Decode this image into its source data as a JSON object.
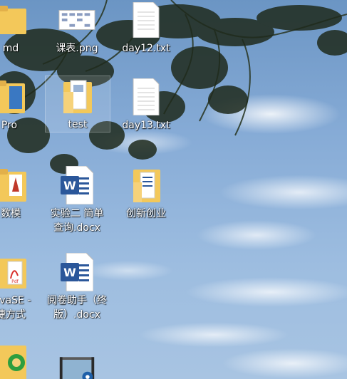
{
  "desktop": {
    "icons": [
      {
        "label": "md",
        "type": "folder"
      },
      {
        "label": "课表.png",
        "type": "image"
      },
      {
        "label": "day12.txt",
        "type": "text-file"
      },
      {
        "label": "Pro",
        "type": "folder"
      },
      {
        "label": "test",
        "type": "folder"
      },
      {
        "label": "day13.txt",
        "type": "text-file"
      },
      {
        "label": "数模",
        "type": "folder"
      },
      {
        "label": "实验二 简单\n查询.docx",
        "type": "word-doc"
      },
      {
        "label": "创新创业",
        "type": "folder"
      },
      {
        "label": "JavaSE -\n捷方式",
        "type": "shortcut"
      },
      {
        "label": "阅卷助手（终\n版）.docx",
        "type": "word-doc"
      },
      {
        "label": "",
        "type": "app"
      },
      {
        "label": "",
        "type": "video"
      }
    ]
  },
  "colors": {
    "folder": "#f3c85a",
    "word_blue": "#2b579a",
    "label_text": "#ffffff"
  }
}
